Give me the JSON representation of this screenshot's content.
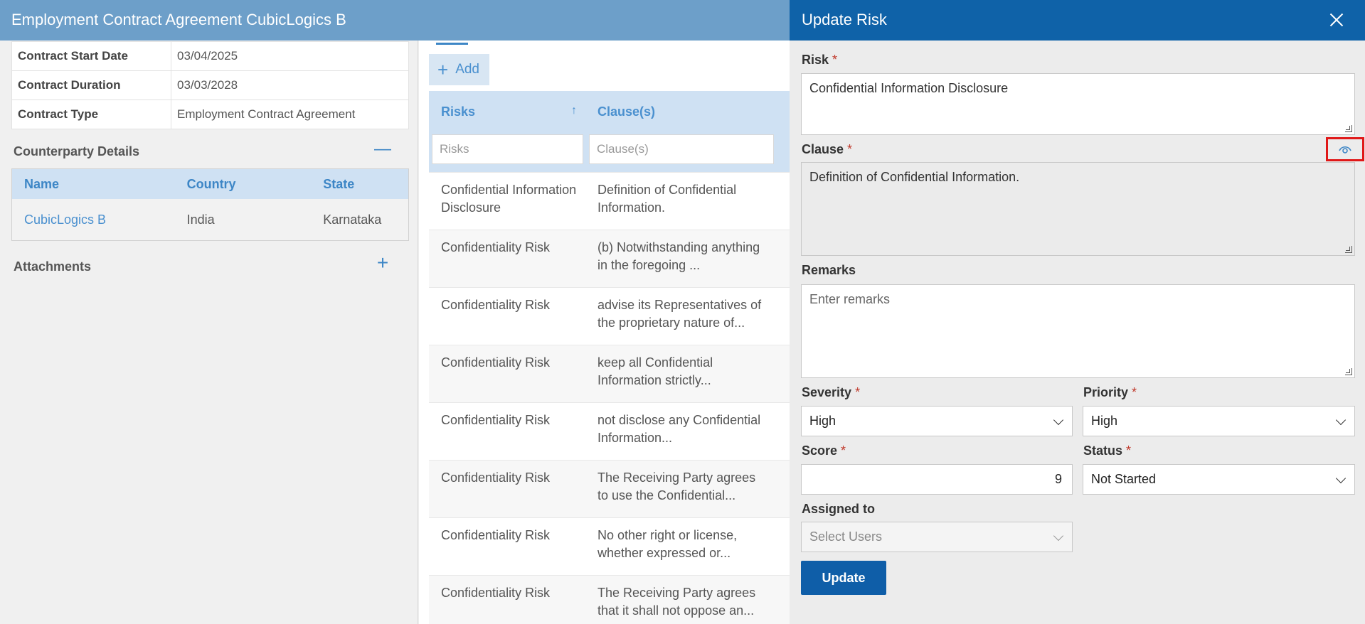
{
  "header": {
    "title": "Employment Contract Agreement CubicLogics B"
  },
  "contract_info": [
    {
      "label": "Contract Start Date",
      "value": "03/04/2025"
    },
    {
      "label": "Contract Duration",
      "value": "03/03/2028"
    },
    {
      "label": "Contract Type",
      "value": "Employment Contract Agreement"
    }
  ],
  "counterparty": {
    "title": "Counterparty Details",
    "toggle_icon": "minus-icon",
    "columns": [
      "Name",
      "Country",
      "State"
    ],
    "rows": [
      {
        "name": "CubicLogics B",
        "country": "India",
        "state": "Karnataka"
      }
    ]
  },
  "attachments": {
    "title": "Attachments",
    "add_icon": "plus-icon"
  },
  "risks_grid": {
    "add_label": "Add",
    "columns": [
      "Risks",
      "Clause(s)"
    ],
    "filter_placeholders": [
      "Risks",
      "Clause(s)"
    ],
    "sort_icon": "arrow-up-icon",
    "rows": [
      {
        "risk": "Confidential Information Disclosure",
        "clause": "Definition of Confidential Information."
      },
      {
        "risk": "Confidentiality Risk",
        "clause": "(b) Notwithstanding anything in the foregoing ..."
      },
      {
        "risk": "Confidentiality Risk",
        "clause": "advise its Representatives of the proprietary nature of..."
      },
      {
        "risk": "Confidentiality Risk",
        "clause": "keep all Confidential Information strictly..."
      },
      {
        "risk": "Confidentiality Risk",
        "clause": "not disclose any Confidential Information..."
      },
      {
        "risk": "Confidentiality Risk",
        "clause": "The Receiving Party agrees to use the Confidential..."
      },
      {
        "risk": "Confidentiality Risk",
        "clause": "No other right or license, whether expressed or..."
      },
      {
        "risk": "Confidentiality Risk",
        "clause": "The Receiving Party agrees that it shall not oppose an..."
      }
    ]
  },
  "dialog": {
    "title": "Update Risk",
    "close_icon": "close-icon",
    "risk": {
      "label": "Risk",
      "required": "*",
      "value": "Confidential Information Disclosure"
    },
    "clause": {
      "label": "Clause",
      "required": "*",
      "value": "Definition of Confidential Information.",
      "view_icon": "eye-icon"
    },
    "remarks": {
      "label": "Remarks",
      "placeholder": "Enter remarks"
    },
    "severity": {
      "label": "Severity",
      "required": "*",
      "value": "High"
    },
    "priority": {
      "label": "Priority",
      "required": "*",
      "value": "High"
    },
    "score": {
      "label": "Score",
      "required": "*",
      "value": "9"
    },
    "status": {
      "label": "Status",
      "required": "*",
      "value": "Not Started"
    },
    "assigned_to": {
      "label": "Assigned to",
      "placeholder": "Select Users"
    },
    "update_label": "Update"
  },
  "colors": {
    "header_bg": "#6d9fc9",
    "dialog_header_bg": "#0f62a8",
    "accent": "#3d86c6",
    "highlight_box": "#e01818"
  }
}
